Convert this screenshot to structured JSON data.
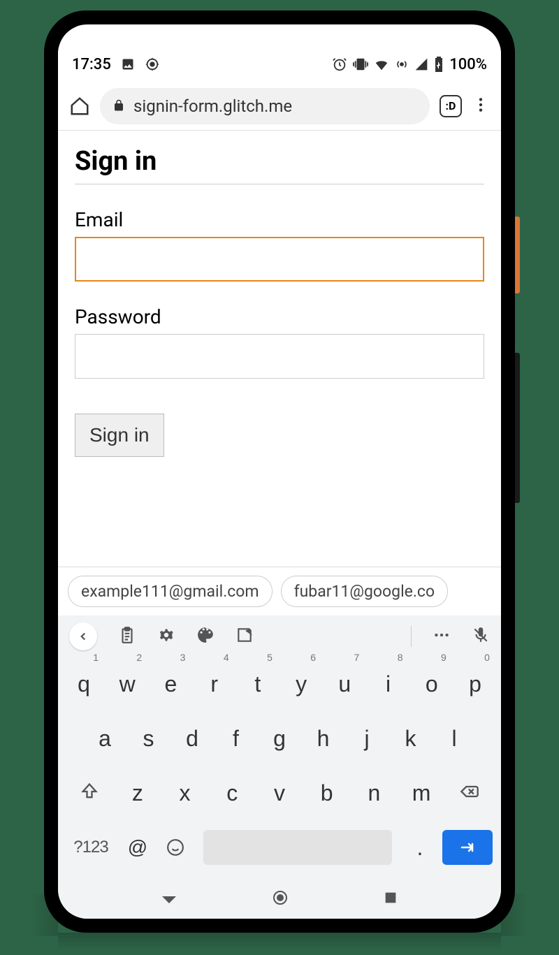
{
  "status_bar": {
    "time": "17:35",
    "battery": "100%"
  },
  "browser": {
    "url": "signin-form.glitch.me",
    "tab_indicator": ":D"
  },
  "page": {
    "title": "Sign in",
    "email_label": "Email",
    "password_label": "Password",
    "signin_button": "Sign in"
  },
  "suggestions": [
    "example111@gmail.com",
    "fubar11@google.co"
  ],
  "keyboard": {
    "row1": [
      {
        "k": "q",
        "n": "1"
      },
      {
        "k": "w",
        "n": "2"
      },
      {
        "k": "e",
        "n": "3"
      },
      {
        "k": "r",
        "n": "4"
      },
      {
        "k": "t",
        "n": "5"
      },
      {
        "k": "y",
        "n": "6"
      },
      {
        "k": "u",
        "n": "7"
      },
      {
        "k": "i",
        "n": "8"
      },
      {
        "k": "o",
        "n": "9"
      },
      {
        "k": "p",
        "n": "0"
      }
    ],
    "row2": [
      "a",
      "s",
      "d",
      "f",
      "g",
      "h",
      "j",
      "k",
      "l"
    ],
    "row3": [
      "z",
      "x",
      "c",
      "v",
      "b",
      "n",
      "m"
    ],
    "sym_key": "?123",
    "at_key": "@",
    "period_key": "."
  }
}
